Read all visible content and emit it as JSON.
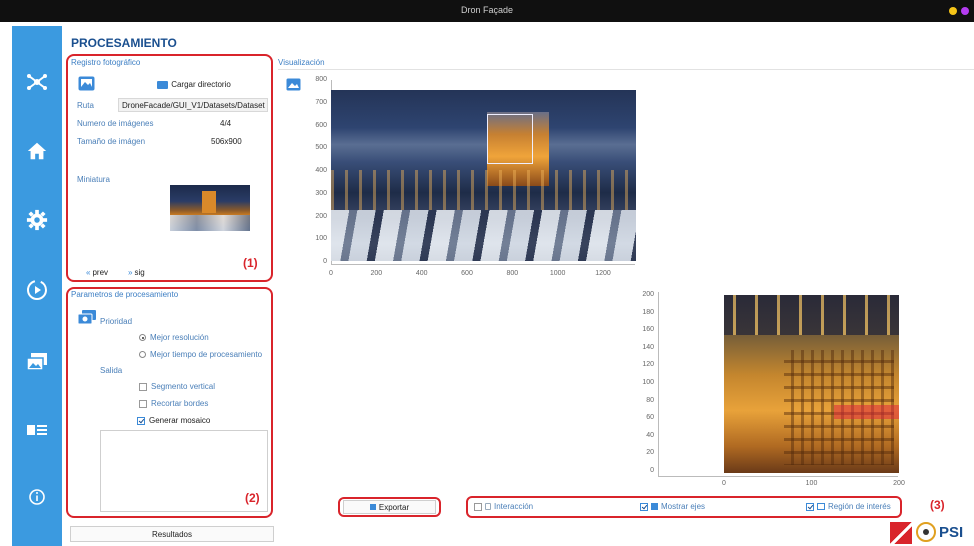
{
  "window": {
    "title": "Dron Façade"
  },
  "page": {
    "title": "PROCESAMIENTO"
  },
  "registro": {
    "group_label": "Registro fotográfico",
    "load_button": "Cargar directorio",
    "ruta_label": "Ruta",
    "ruta_value": "DroneFacade/GUI_V1/Datasets/Dataset",
    "num_label": "Numero de imágenes",
    "num_value": "4/4",
    "size_label": "Tamaño de imágen",
    "size_value": "506x900",
    "thumb_label": "Miniatura",
    "prev_label": "prev",
    "next_label": "sig",
    "annotation": "(1)"
  },
  "params": {
    "group_label": "Parametros de procesamiento",
    "priority_label": "Prioridad",
    "opt_resolution": "Mejor resolución",
    "opt_time": "Mejor tiempo de procesamiento",
    "output_label": "Salida",
    "chk_vertical": "Segmento vertical",
    "chk_borders": "Recortar bordes",
    "chk_mosaic": "Generar mosaico",
    "annotation": "(2)"
  },
  "visual": {
    "group_label": "Visualización",
    "plot1_y_ticks": [
      "800",
      "700",
      "600",
      "500",
      "400",
      "300",
      "200",
      "100",
      "0"
    ],
    "plot1_x_ticks": [
      "0",
      "200",
      "400",
      "600",
      "800",
      "1000",
      "1200"
    ],
    "plot2_y_ticks": [
      "200",
      "180",
      "160",
      "140",
      "120",
      "100",
      "80",
      "60",
      "40",
      "20",
      "0"
    ],
    "plot2_x_ticks": [
      "0",
      "100",
      "200"
    ]
  },
  "bottom": {
    "export_button": "Exportar",
    "interaction_label": "Interacción",
    "axes_label": "Mostrar ejes",
    "roi_label": "Región de interés",
    "annotation": "(3)",
    "results_button": "Resultados"
  },
  "logo": {
    "text": "PSI"
  },
  "colors": {
    "sidebar": "#3b9ae0",
    "annotation_red": "#d9242b",
    "title_blue": "#1a4f8f"
  }
}
